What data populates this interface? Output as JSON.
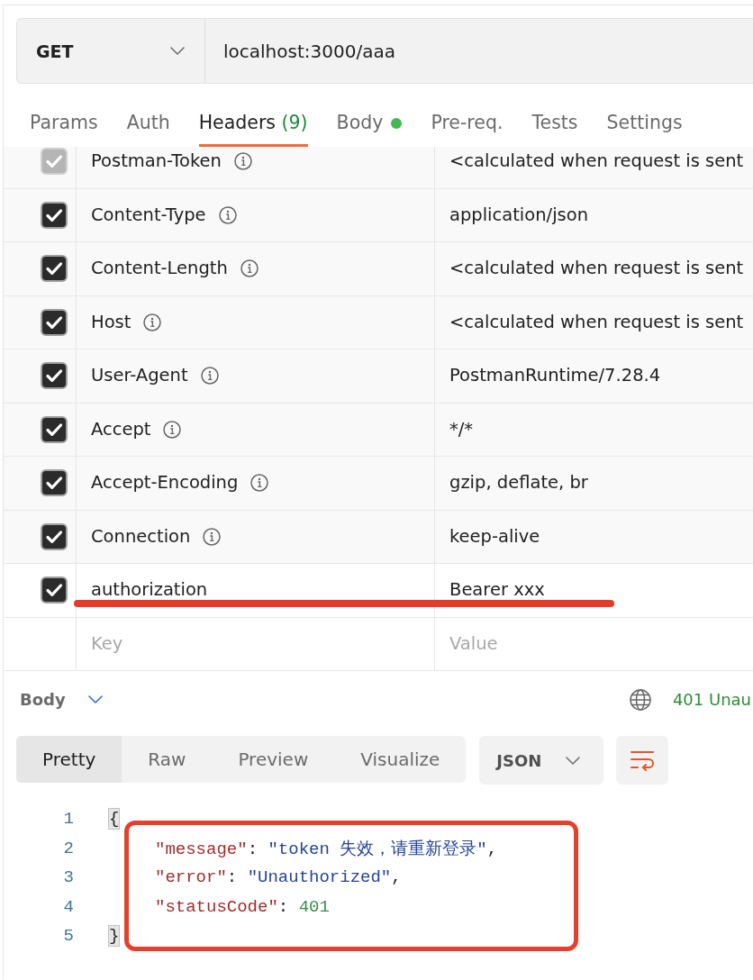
{
  "request": {
    "method": "GET",
    "url": "localhost:3000/aaa"
  },
  "tabs": [
    {
      "label": "Params",
      "selected": false,
      "has_content": false
    },
    {
      "label": "Auth",
      "selected": false,
      "has_content": false
    },
    {
      "label": "Headers",
      "count": "(9)",
      "selected": true,
      "has_content": false
    },
    {
      "label": "Body",
      "selected": false,
      "has_content": true
    },
    {
      "label": "Pre-req.",
      "selected": false,
      "has_content": false
    },
    {
      "label": "Tests",
      "selected": false,
      "has_content": false
    },
    {
      "label": "Settings",
      "selected": false,
      "has_content": false
    }
  ],
  "headers": [
    {
      "kind": "auto",
      "checked": true,
      "disabled": true,
      "underlined": false,
      "key": "Postman-Token",
      "value": "<calculated when request is sent"
    },
    {
      "kind": "auto",
      "checked": true,
      "disabled": false,
      "underlined": false,
      "key": "Content-Type",
      "value": "application/json"
    },
    {
      "kind": "auto",
      "checked": true,
      "disabled": false,
      "underlined": false,
      "key": "Content-Length",
      "value": "<calculated when request is sent"
    },
    {
      "kind": "auto",
      "checked": true,
      "disabled": false,
      "underlined": false,
      "key": "Host",
      "value": "<calculated when request is sent"
    },
    {
      "kind": "auto",
      "checked": true,
      "disabled": false,
      "underlined": false,
      "key": "User-Agent",
      "value": "PostmanRuntime/7.28.4"
    },
    {
      "kind": "auto",
      "checked": true,
      "disabled": false,
      "underlined": false,
      "key": "Accept",
      "value": "*/*"
    },
    {
      "kind": "auto",
      "checked": true,
      "disabled": false,
      "underlined": false,
      "key": "Accept-Encoding",
      "value": "gzip, deflate, br"
    },
    {
      "kind": "auto",
      "checked": true,
      "disabled": false,
      "underlined": false,
      "key": "Connection",
      "value": "keep-alive"
    },
    {
      "kind": "custom",
      "checked": true,
      "disabled": false,
      "underlined": true,
      "key": "authorization",
      "value": "Bearer xxx"
    },
    {
      "kind": "new",
      "key_placeholder": "Key",
      "value_placeholder": "Value"
    }
  ],
  "response": {
    "section": "Body",
    "status": "401 Unau",
    "views": [
      {
        "label": "Pretty",
        "selected": true
      },
      {
        "label": "Raw",
        "selected": false
      },
      {
        "label": "Preview",
        "selected": false
      },
      {
        "label": "Visualize",
        "selected": false
      }
    ],
    "format": "JSON",
    "code": {
      "outlined": true,
      "lines": [
        {
          "number": "1",
          "kind": "open",
          "tokens": [
            {
              "kind": "brace",
              "text": "{"
            }
          ]
        },
        {
          "number": "2",
          "kind": "member",
          "tokens": [
            {
              "kind": "key",
              "text": "\"message\""
            },
            {
              "kind": "punct",
              "text": ": "
            },
            {
              "kind": "string",
              "text": "\"token 失效，请重新登录\""
            },
            {
              "kind": "punct",
              "text": ","
            }
          ]
        },
        {
          "number": "3",
          "kind": "member",
          "tokens": [
            {
              "kind": "key",
              "text": "\"error\""
            },
            {
              "kind": "punct",
              "text": ": "
            },
            {
              "kind": "string",
              "text": "\"Unauthorized\""
            },
            {
              "kind": "punct",
              "text": ","
            }
          ]
        },
        {
          "number": "4",
          "kind": "member",
          "tokens": [
            {
              "kind": "key",
              "text": "\"statusCode\""
            },
            {
              "kind": "punct",
              "text": ": "
            },
            {
              "kind": "number",
              "text": "401"
            }
          ]
        },
        {
          "number": "5",
          "kind": "close",
          "tokens": [
            {
              "kind": "brace",
              "text": "}"
            }
          ]
        }
      ]
    }
  }
}
